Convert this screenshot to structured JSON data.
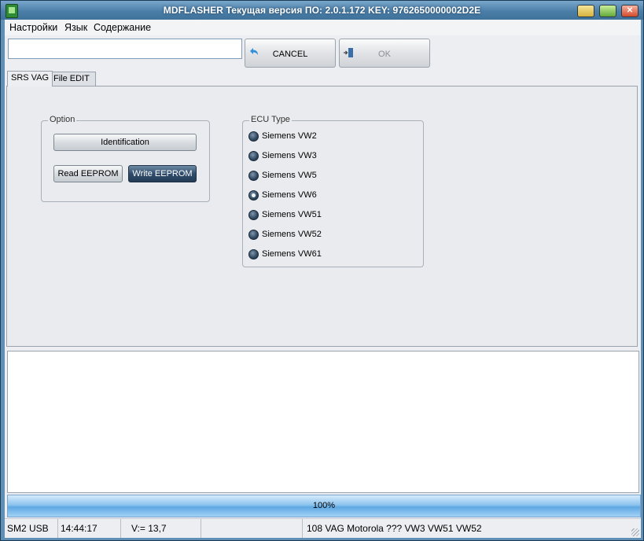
{
  "window": {
    "title": "MDFLASHER  Текущая версия ПО: 2.0.1.172  KEY: 9762650000002D2E",
    "minimize_glyph": "",
    "maximize_glyph": "",
    "close_glyph": "✕"
  },
  "menu": {
    "items": [
      {
        "label": "Настройки"
      },
      {
        "label": "Язык"
      },
      {
        "label": "Содержание"
      }
    ]
  },
  "toolbar": {
    "input_value": "",
    "cancel_label": "CANCEL",
    "ok_label": "OK",
    "cancel_icon": "undo-arrow-icon",
    "ok_icon": "exit-door-icon"
  },
  "tabs": [
    {
      "label": "SRS VAG",
      "active": true
    },
    {
      "label": "File EDIT",
      "active": false
    }
  ],
  "option_group": {
    "title": "Option",
    "identification_label": "Identification",
    "read_label": "Read EEPROM",
    "write_label": "Write EEPROM"
  },
  "ecu_group": {
    "title": "ECU Type",
    "options": [
      {
        "label": "Siemens VW2",
        "checked": false
      },
      {
        "label": "Siemens VW3",
        "checked": false
      },
      {
        "label": "Siemens VW5",
        "checked": false
      },
      {
        "label": "Siemens VW6",
        "checked": true
      },
      {
        "label": "Siemens VW51",
        "checked": false
      },
      {
        "label": "Siemens VW52",
        "checked": false
      },
      {
        "label": "Siemens VW61",
        "checked": false
      }
    ]
  },
  "progress": {
    "label": "100%",
    "value": 1.0
  },
  "status": {
    "connection": "SM2 USB",
    "time": "14:44:17",
    "voltage": "V:= 13,7",
    "empty": "",
    "info": "108 VAG Motorola ??? VW3 VW51 VW52"
  },
  "colors": {
    "titlebar": "#4c7fa8",
    "dark_button": "#2f4d6b",
    "progress": "#5fa8e3"
  }
}
